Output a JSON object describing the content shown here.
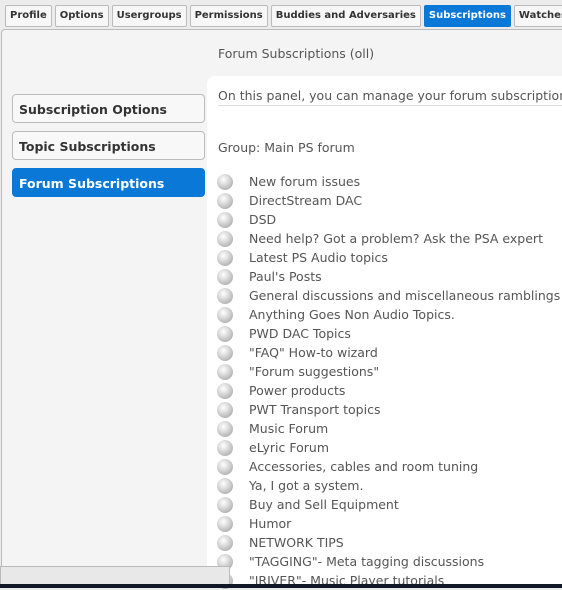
{
  "tabs": [
    "Profile",
    "Options",
    "Usergroups",
    "Permissions",
    "Buddies and Adversaries",
    "Subscriptions",
    "Watches"
  ],
  "active_tab": "Subscriptions",
  "accent": "#0a78d7",
  "header": "Forum Subscriptions (oll)",
  "intro": "On this panel, you can manage your forum subscriptions.",
  "sidebar": [
    "Subscription Options",
    "Topic Subscriptions",
    "Forum Subscriptions"
  ],
  "group": "Group: Main PS forum",
  "forums": [
    "New forum issues",
    "DirectStream DAC",
    "DSD",
    "Need help? Got a problem? Ask the PSA expert",
    "Latest PS Audio topics",
    "Paul's Posts",
    "General discussions and miscellaneous ramblings",
    "Anything Goes Non Audio Topics.",
    "PWD DAC Topics",
    "\"FAQ\" How-to wizard",
    "\"Forum suggestions\"",
    "Power products",
    "PWT Transport topics",
    "Music Forum",
    "eLyric Forum",
    "Accessories, cables and room tuning",
    "Ya, I got a system.",
    "Buy and Sell Equipment",
    "Humor",
    "NETWORK TIPS",
    "\"TAGGING\"- Meta tagging discussions",
    "\"IRIVER\"- Music Player tutorials"
  ]
}
